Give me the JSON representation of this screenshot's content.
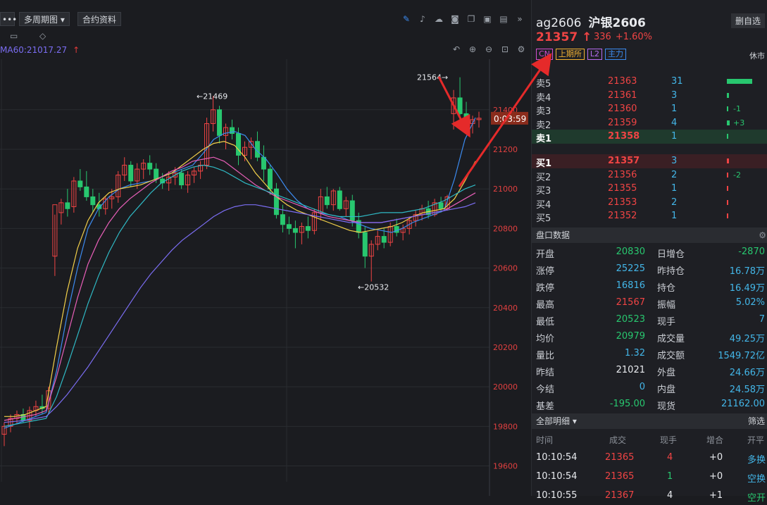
{
  "window": {
    "title_fragment": "mx_r04w9vqi9"
  },
  "toolbar": {
    "more_label": "•••",
    "period_label": "多周期图",
    "contract_info_label": "合约资料"
  },
  "chart_header": {
    "ma_label": "MA60:21017.27"
  },
  "chart_data": {
    "type": "candlestick",
    "y_ticks": [
      19600,
      19800,
      20000,
      20200,
      20400,
      20600,
      20800,
      21000,
      21200,
      21400
    ],
    "ylim": [
      19520,
      21620
    ],
    "annotations": {
      "high_label": "←21469",
      "low_label": "←20532",
      "recent_high_label": "21564→",
      "timer_label": "0:03:59"
    },
    "candles": [
      [
        19760,
        19820,
        19700,
        19800
      ],
      [
        19800,
        19860,
        19770,
        19840
      ],
      [
        19840,
        19880,
        19810,
        19860
      ],
      [
        19860,
        19890,
        19820,
        19830
      ],
      [
        19830,
        19900,
        19790,
        19880
      ],
      [
        19880,
        19930,
        19850,
        19900
      ],
      [
        19900,
        19960,
        19860,
        19890
      ],
      [
        19890,
        20000,
        19870,
        19980
      ],
      [
        20660,
        20870,
        20560,
        20920
      ],
      [
        20880,
        20950,
        20820,
        20930
      ],
      [
        20930,
        21000,
        20860,
        20900
      ],
      [
        20910,
        21060,
        20880,
        21040
      ],
      [
        21040,
        21100,
        20990,
        21010
      ],
      [
        21010,
        21090,
        20940,
        20960
      ],
      [
        20960,
        21000,
        20880,
        20920
      ],
      [
        20920,
        20980,
        20860,
        20900
      ],
      [
        20900,
        20960,
        20870,
        20950
      ],
      [
        20950,
        21000,
        20900,
        20960
      ],
      [
        20960,
        21090,
        20930,
        21070
      ],
      [
        21070,
        21160,
        21040,
        21120
      ],
      [
        21120,
        21140,
        21010,
        21040
      ],
      [
        21040,
        21130,
        21000,
        21100
      ],
      [
        21100,
        21150,
        21050,
        21130
      ],
      [
        21130,
        21170,
        21070,
        21100
      ],
      [
        21100,
        21130,
        21030,
        21050
      ],
      [
        21050,
        21080,
        21000,
        21030
      ],
      [
        21030,
        21090,
        20990,
        21060
      ],
      [
        21060,
        21110,
        21020,
        21080
      ],
      [
        21080,
        21100,
        21000,
        21020
      ],
      [
        21020,
        21090,
        20980,
        21070
      ],
      [
        21070,
        21110,
        21030,
        21090
      ],
      [
        21090,
        21140,
        21050,
        21120
      ],
      [
        21120,
        21360,
        21100,
        21330
      ],
      [
        21330,
        21469,
        21290,
        21400
      ],
      [
        21400,
        21420,
        21230,
        21270
      ],
      [
        21270,
        21330,
        21200,
        21310
      ],
      [
        21310,
        21350,
        21250,
        21280
      ],
      [
        21280,
        21310,
        21120,
        21170
      ],
      [
        21170,
        21240,
        21140,
        21210
      ],
      [
        21210,
        21260,
        21150,
        21240
      ],
      [
        21240,
        21290,
        21140,
        21160
      ],
      [
        21160,
        21220,
        21040,
        21100
      ],
      [
        21100,
        21120,
        20970,
        21000
      ],
      [
        21000,
        21030,
        20850,
        20870
      ],
      [
        20870,
        20920,
        20780,
        20820
      ],
      [
        20820,
        20860,
        20770,
        20800
      ],
      [
        20800,
        20840,
        20700,
        20780
      ],
      [
        20780,
        20830,
        20720,
        20810
      ],
      [
        20810,
        20860,
        20750,
        20790
      ],
      [
        20790,
        20900,
        20770,
        20880
      ],
      [
        20880,
        21000,
        20840,
        20960
      ],
      [
        20960,
        21010,
        20900,
        20920
      ],
      [
        20920,
        21000,
        20890,
        20990
      ],
      [
        20990,
        21010,
        20890,
        20900
      ],
      [
        20900,
        20960,
        20860,
        20940
      ],
      [
        20940,
        20970,
        20810,
        20840
      ],
      [
        20840,
        20880,
        20750,
        20780
      ],
      [
        20780,
        20810,
        20600,
        20660
      ],
      [
        20660,
        20740,
        20532,
        20720
      ],
      [
        20720,
        20790,
        20690,
        20760
      ],
      [
        20760,
        20800,
        20700,
        20730
      ],
      [
        20730,
        20830,
        20710,
        20810
      ],
      [
        20810,
        20850,
        20760,
        20780
      ],
      [
        20780,
        20820,
        20740,
        20800
      ],
      [
        20800,
        20860,
        20770,
        20840
      ],
      [
        20840,
        20890,
        20810,
        20870
      ],
      [
        20870,
        20920,
        20840,
        20900
      ],
      [
        20900,
        20940,
        20850,
        20870
      ],
      [
        20870,
        20950,
        20860,
        20930
      ],
      [
        20930,
        20960,
        20880,
        20900
      ],
      [
        20900,
        20970,
        20890,
        20960
      ],
      [
        21380,
        21500,
        21300,
        21460
      ],
      [
        21460,
        21564,
        21350,
        21380
      ],
      [
        21380,
        21440,
        21290,
        21330
      ],
      [
        21330,
        21370,
        21280,
        21350
      ],
      [
        21350,
        21390,
        21310,
        21357
      ]
    ],
    "ma_lines": [
      {
        "color": "#3c8bf0",
        "values": [
          19790,
          19810,
          19830,
          19850,
          19870,
          20080,
          20360,
          20600,
          20800,
          20900,
          20960,
          21000,
          21020,
          21030,
          21040,
          21060,
          21080,
          21100,
          21120,
          21180,
          21250,
          21280,
          21290,
          21270,
          21200,
          21150,
          21080,
          21000,
          20940,
          20900,
          20880,
          20870,
          20860,
          20840,
          20820,
          20800,
          20790,
          20780,
          20800,
          20830,
          20850,
          20870,
          20890,
          21050,
          21250,
          21360
        ]
      },
      {
        "color": "#f2d04a",
        "values": [
          19850,
          19850,
          19860,
          19880,
          19900,
          20200,
          20480,
          20700,
          20840,
          20930,
          20980,
          21000,
          21010,
          21020,
          21040,
          21060,
          21080,
          21120,
          21160,
          21200,
          21230,
          21240,
          21220,
          21160,
          21080,
          21020,
          20960,
          20920,
          20890,
          20870,
          20850,
          20830,
          20810,
          20790,
          20780,
          20790,
          20800,
          20810,
          20830,
          20860,
          20880,
          20890,
          20900,
          20950,
          21040,
          21140
        ]
      },
      {
        "color": "#e85fb8",
        "values": [
          19830,
          19840,
          19850,
          19860,
          19880,
          20050,
          20250,
          20450,
          20620,
          20740,
          20830,
          20900,
          20950,
          20990,
          21030,
          21060,
          21090,
          21110,
          21140,
          21150,
          21160,
          21140,
          21100,
          21060,
          21020,
          20990,
          20960,
          20940,
          20920,
          20900,
          20880,
          20860,
          20850,
          20840,
          20830,
          20830,
          20830,
          20840,
          20850,
          20860,
          20870,
          20880,
          20890,
          20920,
          20950,
          20980
        ]
      },
      {
        "color": "#2fb9c4",
        "values": [
          19800,
          19810,
          19820,
          19830,
          19840,
          19950,
          20100,
          20260,
          20420,
          20560,
          20680,
          20780,
          20860,
          20920,
          20980,
          21030,
          21060,
          21090,
          21110,
          21120,
          21110,
          21090,
          21060,
          21030,
          21010,
          20990,
          20970,
          20950,
          20930,
          20910,
          20890,
          20870,
          20860,
          20860,
          20860,
          20870,
          20880,
          20880,
          20880,
          20890,
          20900,
          20920,
          20940,
          20970,
          21000,
          21020
        ]
      },
      {
        "color": "#7b6df2",
        "values": [
          19820,
          19825,
          19830,
          19840,
          19850,
          19900,
          19960,
          20030,
          20100,
          20180,
          20260,
          20340,
          20420,
          20500,
          20570,
          20630,
          20690,
          20740,
          20780,
          20820,
          20860,
          20890,
          20910,
          20920,
          20920,
          20910,
          20900,
          20890,
          20880,
          20870,
          20860,
          20850,
          20840,
          20830,
          20830,
          20830,
          20830,
          20840,
          20850,
          20860,
          20870,
          20880,
          20890,
          20900,
          20910,
          20930
        ]
      }
    ]
  },
  "quote": {
    "symbol": "ag2606",
    "name": "沪银2606",
    "add_label": "删自选",
    "price": "21357",
    "arrow": "↑",
    "change": "336",
    "change_pct": "+1.60%",
    "tags": [
      {
        "text": "CN",
        "color": "#d44fd0"
      },
      {
        "text": "上期所",
        "color": "#f2b233"
      },
      {
        "text": "L2",
        "color": "#b56cf0"
      },
      {
        "text": "主力",
        "color": "#3c8bf0"
      }
    ],
    "status": "休市"
  },
  "orderbook": {
    "asks": [
      {
        "label": "卖5",
        "price": "21363",
        "vol": "31",
        "delta": "",
        "bar": 36
      },
      {
        "label": "卖4",
        "price": "21361",
        "vol": "3",
        "delta": "",
        "bar": 3
      },
      {
        "label": "卖3",
        "price": "21360",
        "vol": "1",
        "delta": "-1",
        "bar": 1
      },
      {
        "label": "卖2",
        "price": "21359",
        "vol": "4",
        "delta": "+3",
        "bar": 4
      },
      {
        "label": "卖1",
        "price": "21358",
        "vol": "1",
        "delta": "",
        "bar": 1
      }
    ],
    "bids": [
      {
        "label": "买1",
        "price": "21357",
        "vol": "3",
        "delta": "",
        "bar": 3
      },
      {
        "label": "买2",
        "price": "21356",
        "vol": "2",
        "delta": "-2",
        "bar": 2
      },
      {
        "label": "买3",
        "price": "21355",
        "vol": "1",
        "delta": "",
        "bar": 1
      },
      {
        "label": "买4",
        "price": "21353",
        "vol": "2",
        "delta": "",
        "bar": 2
      },
      {
        "label": "买5",
        "price": "21352",
        "vol": "1",
        "delta": "",
        "bar": 1
      }
    ]
  },
  "market_data": {
    "title": "盘口数据",
    "rows": [
      {
        "l1": "开盘",
        "v1": "20830",
        "c1": "#28c76f",
        "l2": "日增仓",
        "v2": "-2870",
        "c2": "#28c76f"
      },
      {
        "l1": "涨停",
        "v1": "25225",
        "c1": "#43b6e8",
        "l2": "昨持仓",
        "v2": "16.78万",
        "c2": "#43b6e8"
      },
      {
        "l1": "跌停",
        "v1": "16816",
        "c1": "#43b6e8",
        "l2": "持仓",
        "v2": "16.49万",
        "c2": "#43b6e8"
      },
      {
        "l1": "最高",
        "v1": "21567",
        "c1": "#f04444",
        "l2": "振幅",
        "v2": "5.02%",
        "c2": "#43b6e8"
      },
      {
        "l1": "最低",
        "v1": "20523",
        "c1": "#28c76f",
        "l2": "现手",
        "v2": "7",
        "c2": "#43b6e8"
      },
      {
        "l1": "均价",
        "v1": "20979",
        "c1": "#28c76f",
        "l2": "成交量",
        "v2": "49.25万",
        "c2": "#43b6e8"
      },
      {
        "l1": "量比",
        "v1": "1.32",
        "c1": "#43b6e8",
        "l2": "成交额",
        "v2": "1549.72亿",
        "c2": "#43b6e8"
      },
      {
        "l1": "昨结",
        "v1": "21021",
        "c1": "#e8eaee",
        "l2": "外盘",
        "v2": "24.66万",
        "c2": "#43b6e8"
      },
      {
        "l1": "今结",
        "v1": "0",
        "c1": "#43b6e8",
        "l2": "内盘",
        "v2": "24.58万",
        "c2": "#43b6e8"
      },
      {
        "l1": "基差",
        "v1": "-195.00",
        "c1": "#28c76f",
        "l2": "现货",
        "v2": "21162.00",
        "c2": "#43b6e8"
      }
    ]
  },
  "trades": {
    "title": "全部明细",
    "filter_label": "筛选",
    "headers": [
      "时间",
      "成交",
      "现手",
      "增合",
      "开平"
    ],
    "rows": [
      {
        "time": "10:10:54",
        "price": "21365",
        "qty": "4",
        "qty_color": "#f04444",
        "delta": "+0",
        "type": "多换",
        "type_color": "#43b6e8"
      },
      {
        "time": "10:10:54",
        "price": "21365",
        "qty": "1",
        "qty_color": "#28c76f",
        "delta": "+0",
        "type": "空换",
        "type_color": "#43b6e8"
      },
      {
        "time": "10:10:55",
        "price": "21367",
        "qty": "4",
        "qty_color": "#e8eaee",
        "delta": "+1",
        "type": "空开",
        "type_color": "#28c76f"
      }
    ]
  }
}
